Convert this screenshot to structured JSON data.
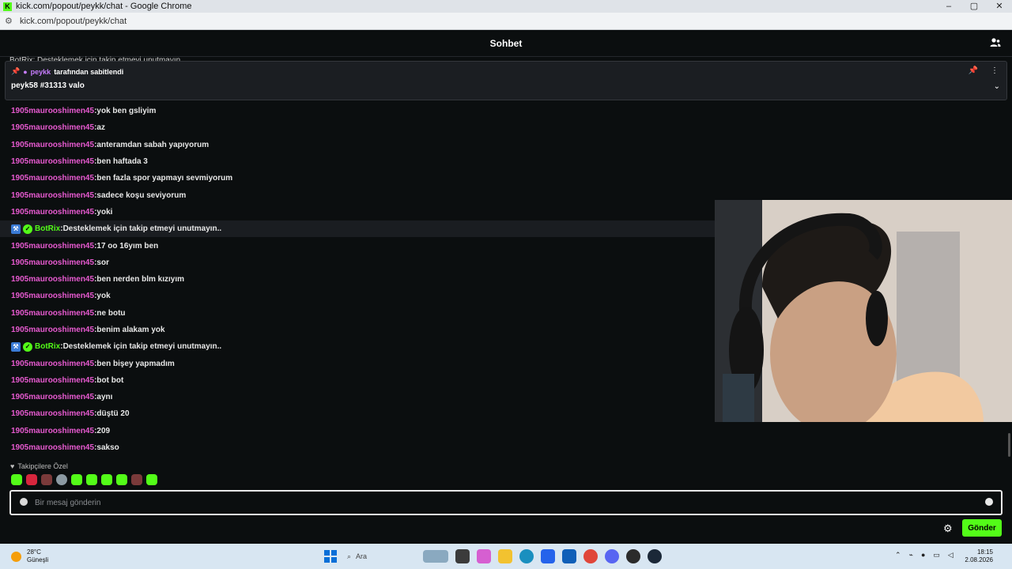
{
  "browser": {
    "window_title": "kick.com/popout/peykk/chat - Google Chrome",
    "url": "kick.com/popout/peykk/chat",
    "controls": [
      "–",
      "▢",
      "✕"
    ]
  },
  "header": {
    "title": "Sohbet"
  },
  "cut_message": "BotRix: Desteklemek için takip etmeyi unutmayın..",
  "pinned": {
    "by_user": "peykk",
    "by_suffix": "tarafından sabitlendi",
    "message": "peyk58 #31313 valo"
  },
  "messages": [
    {
      "user": "1905maurooshimen45",
      "text": "yok ben gsliyim",
      "bot": false
    },
    {
      "user": "1905maurooshimen45",
      "text": "az",
      "bot": false
    },
    {
      "user": "1905maurooshimen45",
      "text": "anteramdan sabah yapıyorum",
      "bot": false
    },
    {
      "user": "1905maurooshimen45",
      "text": "ben haftada 3",
      "bot": false
    },
    {
      "user": "1905maurooshimen45",
      "text": "ben fazla spor yapmayı sevmiyorum",
      "bot": false
    },
    {
      "user": "1905maurooshimen45",
      "text": "sadece koşu seviyorum",
      "bot": false
    },
    {
      "user": "1905maurooshimen45",
      "text": "yoki",
      "bot": false
    },
    {
      "user": "BotRix",
      "text": "Desteklemek için takip etmeyi unutmayın..",
      "bot": true
    },
    {
      "user": "1905maurooshimen45",
      "text": "17 oo 16yım ben",
      "bot": false
    },
    {
      "user": "1905maurooshimen45",
      "text": "sor",
      "bot": false
    },
    {
      "user": "1905maurooshimen45",
      "text": "ben nerden blm kızıyım",
      "bot": false
    },
    {
      "user": "1905maurooshimen45",
      "text": "yok",
      "bot": false
    },
    {
      "user": "1905maurooshimen45",
      "text": "ne botu",
      "bot": false
    },
    {
      "user": "1905maurooshimen45",
      "text": "benim alakam yok",
      "bot": false
    },
    {
      "user": "BotRix",
      "text": "Desteklemek için takip etmeyi unutmayın..",
      "bot": true
    },
    {
      "user": "1905maurooshimen45",
      "text": "ben bişey yapmadım",
      "bot": false
    },
    {
      "user": "1905maurooshimen45",
      "text": "bot bot",
      "bot": false
    },
    {
      "user": "1905maurooshimen45",
      "text": "aynı",
      "bot": false
    },
    {
      "user": "1905maurooshimen45",
      "text": "düştü 20",
      "bot": false
    },
    {
      "user": "1905maurooshimen45",
      "text": "209",
      "bot": false
    },
    {
      "user": "1905maurooshimen45",
      "text": "sakso",
      "bot": false
    }
  ],
  "followers_only": {
    "label": "Takipçilere Özel"
  },
  "input": {
    "placeholder": "Bir mesaj gönderin"
  },
  "send_button": {
    "label": "Gönder"
  },
  "taskbar": {
    "weather_temp": "28°C",
    "weather_desc": "Güneşli",
    "search_label": "Ara",
    "time": "18:15",
    "date": "2.08.2026"
  },
  "colors": {
    "accent": "#53fc18",
    "username": "#e75ad0",
    "background": "#0b0e0f"
  }
}
